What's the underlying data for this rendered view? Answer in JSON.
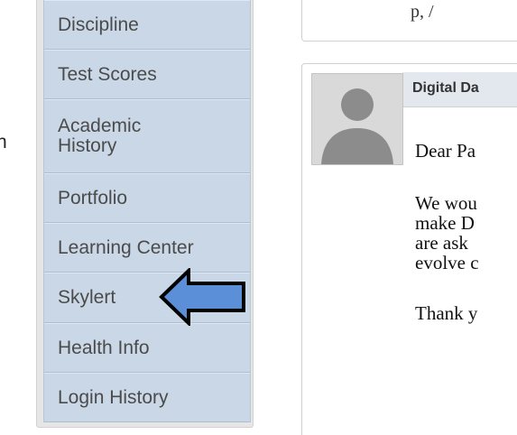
{
  "left_edge_fragment": "n",
  "sidebar": {
    "items": [
      {
        "label": "Discipline"
      },
      {
        "label": "Test Scores"
      },
      {
        "label": "Academic\nHistory"
      },
      {
        "label": "Portfolio"
      },
      {
        "label": "Learning Center"
      },
      {
        "label": "Skylert"
      },
      {
        "label": "Health Info"
      },
      {
        "label": "Login History"
      }
    ]
  },
  "main": {
    "top_fragment": "p, /",
    "post": {
      "title": "Digital Da",
      "greeting": "Dear Pa",
      "paragraph_lines": [
        "We wou",
        "make D",
        "are ask",
        "evolve c"
      ],
      "closing": "Thank y"
    }
  },
  "colors": {
    "sidebar_bg": "#c9d7e6",
    "arrow_fill": "#5b8fd8",
    "arrow_outline": "#000000"
  },
  "icons": {
    "avatar": "person-silhouette-icon",
    "pointer": "left-arrow-icon"
  }
}
